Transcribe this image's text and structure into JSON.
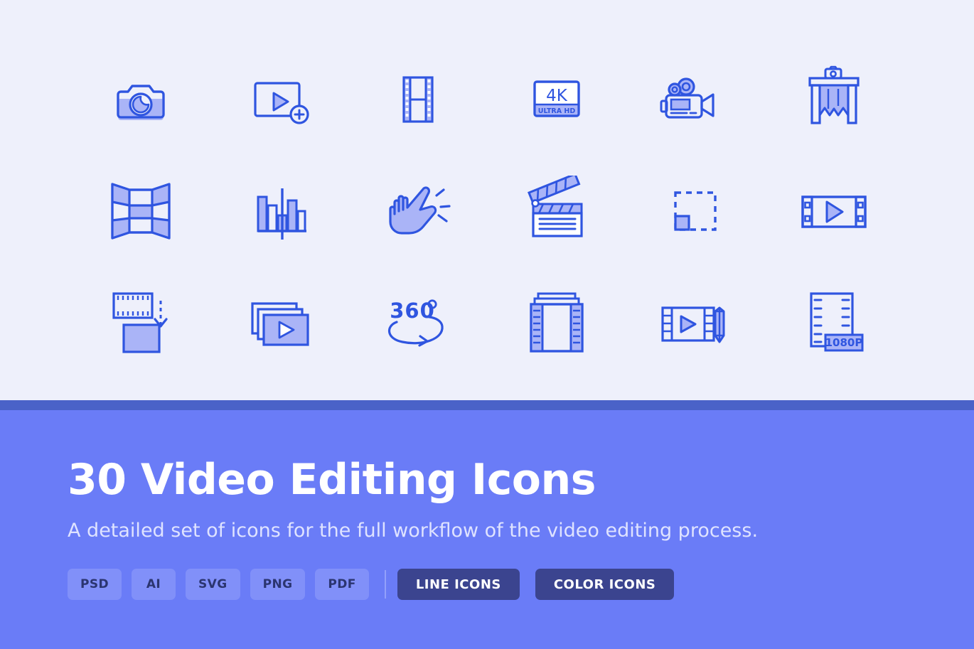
{
  "colors": {
    "background": "#eef0fb",
    "stroke": "#2f55e0",
    "fill": "#aab4f7",
    "divider": "#4a62c8",
    "banner": "#6a7cf7",
    "tag_bg": "#8190f9",
    "tag_text": "#2b3570",
    "button_bg": "#3b448f",
    "button_text": "#ffffff",
    "subtitle": "#dfe3ff"
  },
  "showcase": {
    "icons": [
      {
        "name": "camera-icon",
        "label": "Photo camera"
      },
      {
        "name": "add-video-icon",
        "label": "Add video"
      },
      {
        "name": "film-strip-vertical-icon",
        "label": "Film strip"
      },
      {
        "name": "4k-ultra-hd-icon",
        "label": "4K Ultra HD",
        "text": "4K",
        "subtext": "ULTRA HD"
      },
      {
        "name": "movie-camera-icon",
        "label": "Movie camera"
      },
      {
        "name": "studio-backdrop-icon",
        "label": "Studio backdrop"
      },
      {
        "name": "panorama-grid-icon",
        "label": "Panorama grid"
      },
      {
        "name": "audio-levels-icon",
        "label": "Audio levels"
      },
      {
        "name": "snap-gesture-icon",
        "label": "Snap gesture"
      },
      {
        "name": "clapperboard-icon",
        "label": "Clapperboard"
      },
      {
        "name": "crop-selection-icon",
        "label": "Crop selection"
      },
      {
        "name": "film-play-icon",
        "label": "Film play"
      },
      {
        "name": "export-frame-icon",
        "label": "Export frame"
      },
      {
        "name": "video-stack-icon",
        "label": "Video stack"
      },
      {
        "name": "360-rotation-icon",
        "label": "360 degree video",
        "text": "360"
      },
      {
        "name": "film-reel-icon",
        "label": "Film reel"
      },
      {
        "name": "video-edit-icon",
        "label": "Video edit"
      },
      {
        "name": "1080p-resolution-icon",
        "label": "1080P resolution",
        "text": "1080P"
      }
    ]
  },
  "banner": {
    "title": "30 Video Editing Icons",
    "subtitle": "A detailed set of icons for the full workflow of the video editing process.",
    "tags": [
      "PSD",
      "AI",
      "SVG",
      "PNG",
      "PDF"
    ],
    "buttons": [
      {
        "name": "line-icons-button",
        "label": "LINE ICONS"
      },
      {
        "name": "color-icons-button",
        "label": "COLOR ICONS"
      }
    ]
  }
}
